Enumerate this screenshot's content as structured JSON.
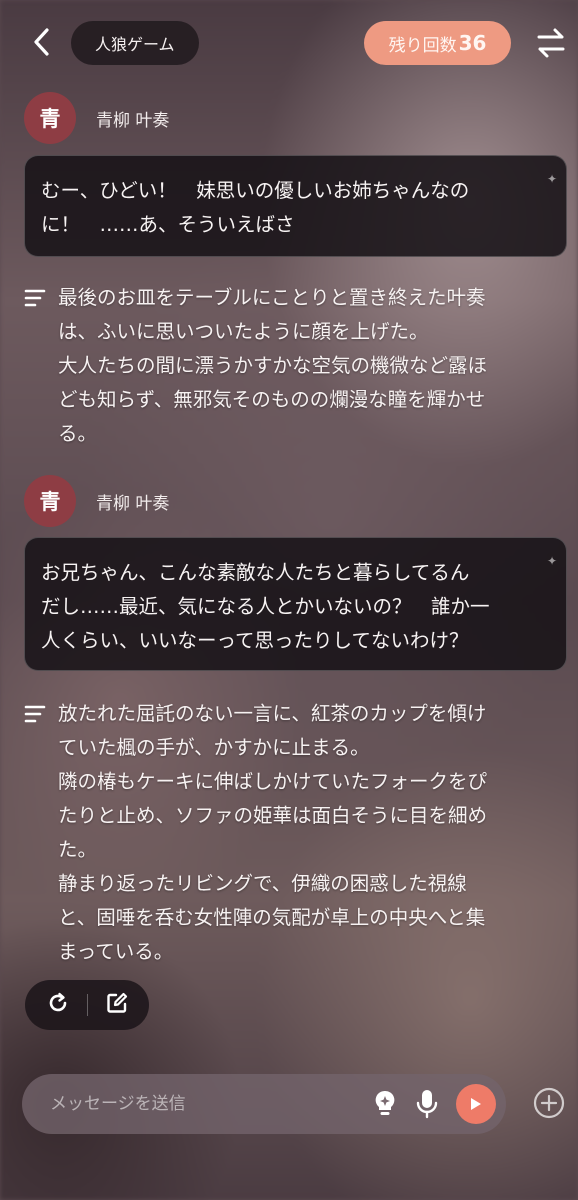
{
  "header": {
    "title": "人狼ゲーム",
    "remaining_label": "残り回数",
    "remaining_count": "36"
  },
  "messages": [
    {
      "speaker": {
        "avatar_char": "青",
        "name": "青柳 叶奏"
      },
      "dialogue": [
        "むー、ひどい！　妹思いの優しいお姉ちゃんなの",
        "に！　……あ、そういえばさ"
      ],
      "narration": [
        "最後のお皿をテーブルにことりと置き終えた叶奏",
        "は、ふいに思いついたように顔を上げた。",
        "大人たちの間に漂うかすかな空気の機微など露ほ",
        "ども知らず、無邪気そのものの爛漫な瞳を輝かせ",
        "る。"
      ]
    },
    {
      "speaker": {
        "avatar_char": "青",
        "name": "青柳 叶奏"
      },
      "dialogue": [
        "お兄ちゃん、こんな素敵な人たちと暮らしてるん",
        "だし……最近、気になる人とかいないの？　誰か一",
        "人くらい、いいなーって思ったりしてないわけ？"
      ],
      "narration": [
        "放たれた屈託のない一言に、紅茶のカップを傾け",
        "ていた楓の手が、かすかに止まる。",
        "隣の椿もケーキに伸ばしかけていたフォークをぴ",
        "たりと止め、ソファの姫華は面白そうに目を細め",
        "た。",
        "静まり返ったリビングで、伊織の困惑した視線",
        "と、固唾を呑む女性陣の気配が卓上の中央へと集",
        "まっている。"
      ]
    }
  ],
  "actions": {
    "regenerate_icon": "refresh-icon",
    "edit_icon": "edit-icon"
  },
  "composer": {
    "placeholder": "メッセージを送信",
    "value": "",
    "icons": [
      "lightbulb-icon",
      "microphone-icon",
      "send-icon",
      "plus-icon"
    ],
    "send_color": "#ee7b68"
  },
  "colors": {
    "accent": "#ee9a82",
    "avatar": "#8e3d44"
  }
}
